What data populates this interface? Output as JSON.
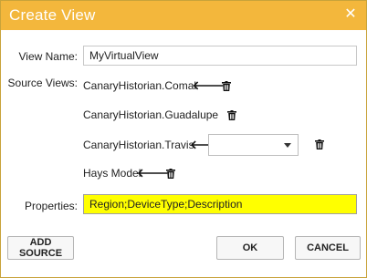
{
  "dialog": {
    "title": "Create View",
    "close_glyph": "✕",
    "accent_color": "#f3b73c"
  },
  "form": {
    "view_name_label": "View Name:",
    "view_name_value": "MyVirtualView",
    "source_views_label": "Source Views:",
    "source_views": [
      {
        "name": "CanaryHistorian.Comal"
      },
      {
        "name": "CanaryHistorian.Guadalupe"
      },
      {
        "name": "CanaryHistorian.Travis",
        "has_dropdown": true,
        "dropdown_value": ""
      },
      {
        "name": "Hays Model"
      }
    ],
    "properties_label": "Properties:",
    "properties_value": "Region;DeviceType;Description",
    "properties_highlight": "#ffff00"
  },
  "icons": {
    "arrow": "arrow-left-icon",
    "trash": "trash-icon",
    "arrow_glyph": "🡐"
  },
  "buttons": {
    "add_source": "ADD SOURCE",
    "ok": "OK",
    "cancel": "CANCEL"
  }
}
